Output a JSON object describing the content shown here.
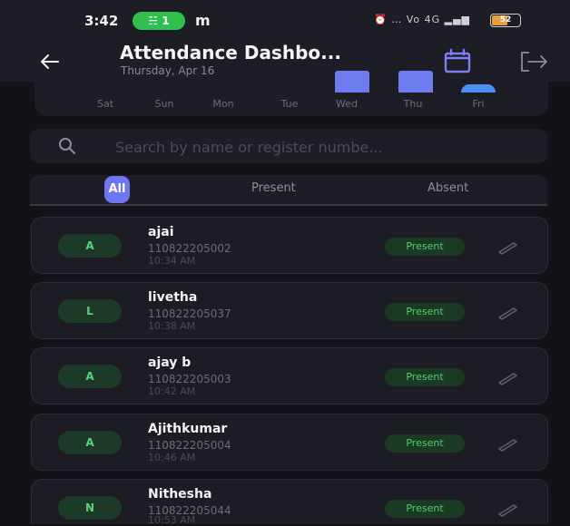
{
  "status_bar": {
    "time": "3:42",
    "call_pill": "☵ 1",
    "carrier_letter": "m",
    "right_indicators": "⏰ … Vo 4G ▂▄▆",
    "battery": "52"
  },
  "header": {
    "title": "Attendance Dashbo...",
    "subtitle": "Thursday, Apr 16",
    "back_icon": "arrow-left-icon",
    "calendar_icon": "calendar-icon",
    "logout_icon": "logout-icon"
  },
  "week_chart": {
    "days": [
      "Sat",
      "Sun",
      "Mon",
      "Tue",
      "Wed",
      "Thu",
      "Fri"
    ],
    "bar_color": "#6f7cf0",
    "accent_color": "#4d8df5"
  },
  "search": {
    "placeholder": "Search by name or register numbe...",
    "icon": "search-icon"
  },
  "tabs": [
    {
      "label": "All",
      "active": true
    },
    {
      "label": "Present",
      "active": false
    },
    {
      "label": "Absent",
      "active": false
    }
  ],
  "students": [
    {
      "initial": "A",
      "name": "ajai",
      "reg": "110822205002",
      "time": "10:34 AM",
      "status": "Present"
    },
    {
      "initial": "L",
      "name": "livetha",
      "reg": "110822205037",
      "time": "10:38 AM",
      "status": "Present"
    },
    {
      "initial": "A",
      "name": "ajay b",
      "reg": "110822205003",
      "time": "10:42 AM",
      "status": "Present"
    },
    {
      "initial": "A",
      "name": "Ajithkumar",
      "reg": "110822205004",
      "time": "10:46 AM",
      "status": "Present"
    },
    {
      "initial": "N",
      "name": "Nithesha",
      "reg": "110822205044",
      "time": "10:53 AM",
      "status": "Present"
    }
  ],
  "colors": {
    "background": "#121218",
    "surface": "#1d1d26",
    "accent": "#6f76f2",
    "present_text": "#4fcf71",
    "present_bg": "#1a3a23"
  }
}
